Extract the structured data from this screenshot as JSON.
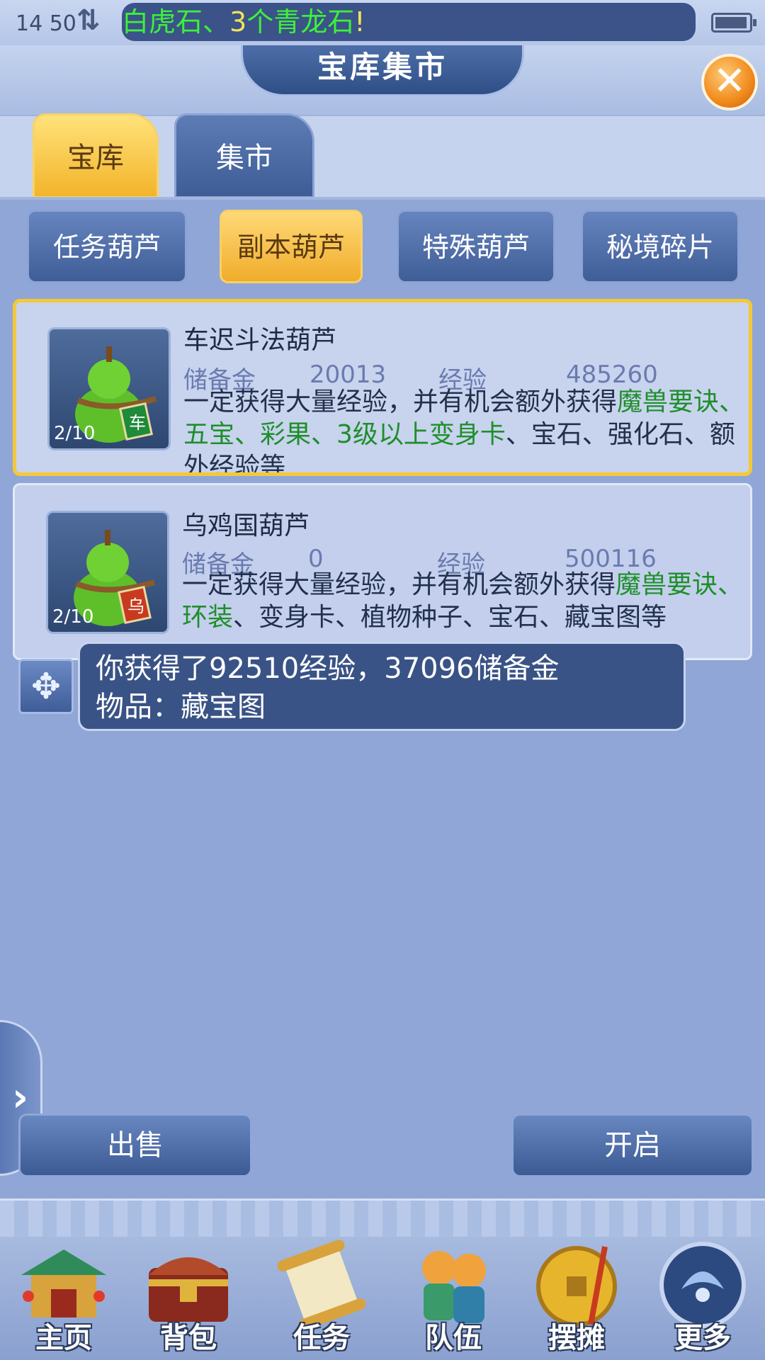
{
  "status_bar": {
    "time": "14 50",
    "net_icon": "data-transfer-icon",
    "battery_icon": "battery-icon"
  },
  "ticker": {
    "part1": "白虎石、",
    "part2": "3",
    "part3": "个青龙石",
    "part4": "!"
  },
  "header": {
    "title": "宝库集市",
    "close_label": "✕"
  },
  "tabs": [
    {
      "label": "宝库",
      "active": true
    },
    {
      "label": "集市",
      "active": false
    }
  ],
  "sub_tabs": [
    {
      "label": "任务葫芦",
      "active": false
    },
    {
      "label": "副本葫芦",
      "active": true
    },
    {
      "label": "特殊葫芦",
      "active": false
    },
    {
      "label": "秘境碎片",
      "active": false
    }
  ],
  "items": [
    {
      "name": "车迟斗法葫芦",
      "count": "2/10",
      "reserve_label": "储备金",
      "reserve_value": "20013",
      "exp_label": "经验",
      "exp_value": "485260",
      "tag": "车",
      "desc_plain1": "一定获得大量经验，并有机会额外获得",
      "desc_hl1": "魔兽要诀、五宝、彩果、3级以上变身卡",
      "desc_plain2": "、宝石、强化石、额外经验等",
      "selected": true
    },
    {
      "name": "乌鸡国葫芦",
      "count": "2/10",
      "reserve_label": "储备金",
      "reserve_value": "0",
      "exp_label": "经验",
      "exp_value": "500116",
      "tag": "乌",
      "desc_plain1": "一定获得大量经验，并有机会额外获得",
      "desc_hl1": "魔兽要诀、环装",
      "desc_plain2": "、变身卡、植物种子、宝石、藏宝图等",
      "selected": false
    }
  ],
  "notice": {
    "line1": "你获得了92510经验，37096储备金",
    "line2": "物品：藏宝图"
  },
  "drawer": {
    "label": "›"
  },
  "actions": {
    "sell": "出售",
    "open": "开启"
  },
  "bottom_nav": [
    {
      "label": "主页",
      "icon": "pavilion-icon"
    },
    {
      "label": "背包",
      "icon": "treasure-chest-icon"
    },
    {
      "label": "任务",
      "icon": "scroll-icon"
    },
    {
      "label": "队伍",
      "icon": "team-icon"
    },
    {
      "label": "摆摊",
      "icon": "coin-icon"
    },
    {
      "label": "更多",
      "icon": "more-icon"
    }
  ],
  "colors": {
    "accent_gold": "#f5c836",
    "panel_blue": "#3a5386",
    "highlight_green": "#1e8f2a"
  }
}
